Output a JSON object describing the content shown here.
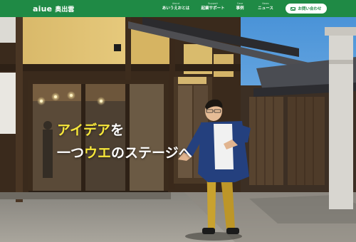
{
  "header": {
    "logo_text": "aiue",
    "brand_name": "奥出雲",
    "nav": [
      {
        "sub": "About",
        "label": "あいうえおとは"
      },
      {
        "sub": "Support",
        "label": "起業サポート"
      },
      {
        "sub": "Case",
        "label": "事例"
      },
      {
        "sub": "News",
        "label": "ニュース"
      }
    ],
    "contact_label": "お問い合わせ",
    "colors": {
      "bar": "#1f8a45",
      "accent": "#f6e63a"
    }
  },
  "hero": {
    "catch_1": {
      "hl": "アイデア",
      "rest": "を"
    },
    "catch_2": {
      "pre": "一つ",
      "hl": "ウエ",
      "post": "のステージへ"
    }
  }
}
